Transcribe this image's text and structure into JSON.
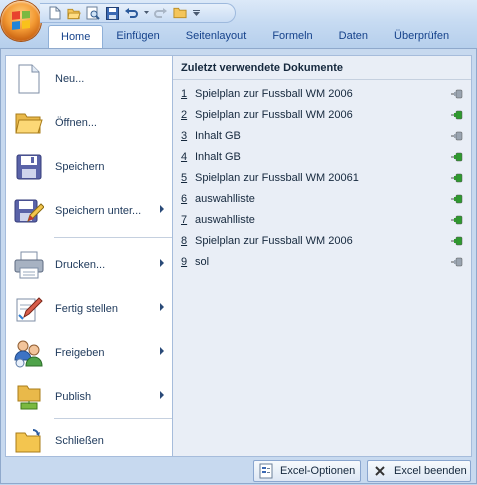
{
  "ribbon": {
    "tabs": [
      "Home",
      "Einfügen",
      "Seitenlayout",
      "Formeln",
      "Daten",
      "Überprüfen"
    ]
  },
  "office_menu": {
    "items": [
      {
        "label": "Neu...",
        "icon": "new-document-icon",
        "has_submenu": false
      },
      {
        "label": "Öffnen...",
        "icon": "open-folder-icon",
        "has_submenu": false
      },
      {
        "label": "Speichern",
        "icon": "save-disk-icon",
        "has_submenu": false
      },
      {
        "label": "Speichern unter...",
        "icon": "save-as-icon",
        "has_submenu": true
      },
      {
        "label": "Drucken...",
        "icon": "printer-icon",
        "has_submenu": true
      },
      {
        "label": "Fertig stellen",
        "icon": "finish-pen-icon",
        "has_submenu": true
      },
      {
        "label": "Freigeben",
        "icon": "share-people-icon",
        "has_submenu": true
      },
      {
        "label": "Publish",
        "icon": "publish-icon",
        "has_submenu": true
      },
      {
        "label": "Schließen",
        "icon": "close-folder-icon",
        "has_submenu": false
      }
    ]
  },
  "recent": {
    "title": "Zuletzt verwendete Dokumente",
    "documents": [
      {
        "num": "1",
        "name": "Spielplan zur Fussball WM 2006",
        "pinned": false
      },
      {
        "num": "2",
        "name": "Spielplan zur Fussball WM 2006",
        "pinned": true
      },
      {
        "num": "3",
        "name": "Inhalt GB",
        "pinned": false
      },
      {
        "num": "4",
        "name": "Inhalt GB",
        "pinned": true
      },
      {
        "num": "5",
        "name": "Spielplan zur Fussball WM 20061",
        "pinned": true
      },
      {
        "num": "6",
        "name": "auswahlliste",
        "pinned": true
      },
      {
        "num": "7",
        "name": "auswahlliste",
        "pinned": true
      },
      {
        "num": "8",
        "name": "Spielplan zur Fussball WM 2006",
        "pinned": true
      },
      {
        "num": "9",
        "name": "sol",
        "pinned": false
      }
    ]
  },
  "footer": {
    "options_label": "Excel-Optionen",
    "exit_label": "Excel beenden"
  },
  "colors": {
    "pin_active": "#2e9a2e",
    "pin_inactive": "#9aa4b0"
  }
}
